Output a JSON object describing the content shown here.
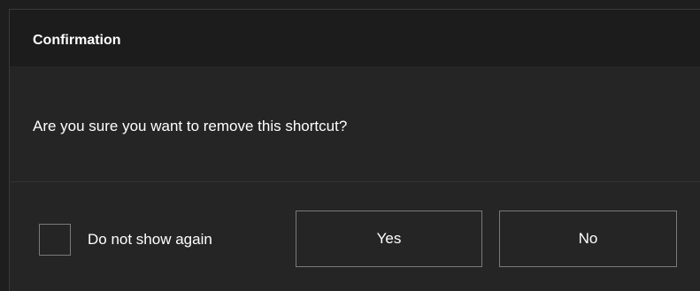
{
  "dialog": {
    "title": "Confirmation",
    "message": "Are you sure you want to remove this shortcut?",
    "checkbox": {
      "label": "Do not show again",
      "checked": false
    },
    "buttons": {
      "yes_label": "Yes",
      "no_label": "No"
    }
  },
  "colors": {
    "background": "#1e1e1e",
    "dialog_body": "#252525",
    "title_bar": "#1c1c1c",
    "text": "#ffffff",
    "border": "#7a7a7a"
  }
}
